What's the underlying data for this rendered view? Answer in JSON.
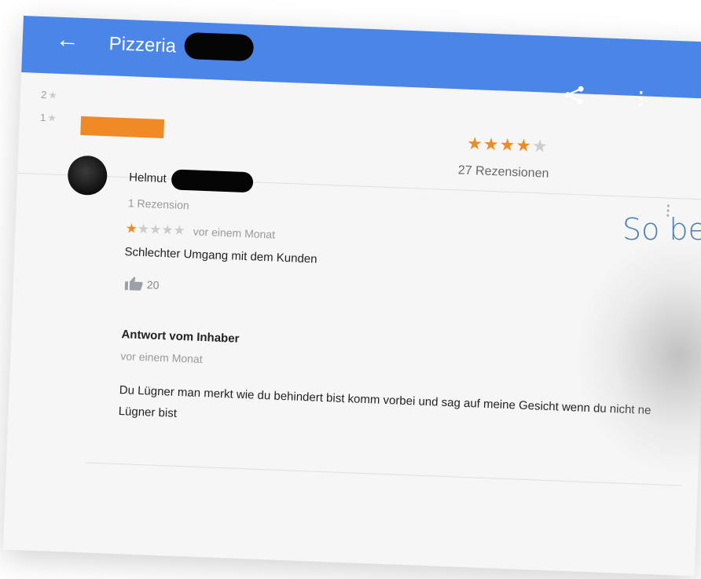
{
  "appbar": {
    "title": "Pizzeria",
    "back_icon": "arrow-left-icon",
    "share_icon": "share-icon",
    "menu_icon": "more-vert-icon",
    "color": "#4a86e8"
  },
  "histogram": [
    {
      "label": "2",
      "star": "★"
    },
    {
      "label": "1",
      "star": "★"
    }
  ],
  "summary": {
    "stars_filled": "★★★★",
    "stars_empty": "★",
    "count_text": "27 Rezensionen",
    "accent": "#f08a24"
  },
  "review": {
    "author": "Helmut",
    "author_reviews": "1 Rezension",
    "stars_filled": "★",
    "stars_empty": "★★★★",
    "date": "vor einem Monat",
    "text": "Schlechter Umgang mit dem Kunden",
    "likes": "20",
    "like_icon": "thumbs-up-icon"
  },
  "owner_reply": {
    "heading": "Antwort vom Inhaber",
    "date": "vor einem Monat",
    "text": "Du Lügner man merkt wie du behindert bist komm vorbei und sag auf meine Gesicht wenn du nicht ne Lügner bist"
  },
  "overlay_text": "So be"
}
